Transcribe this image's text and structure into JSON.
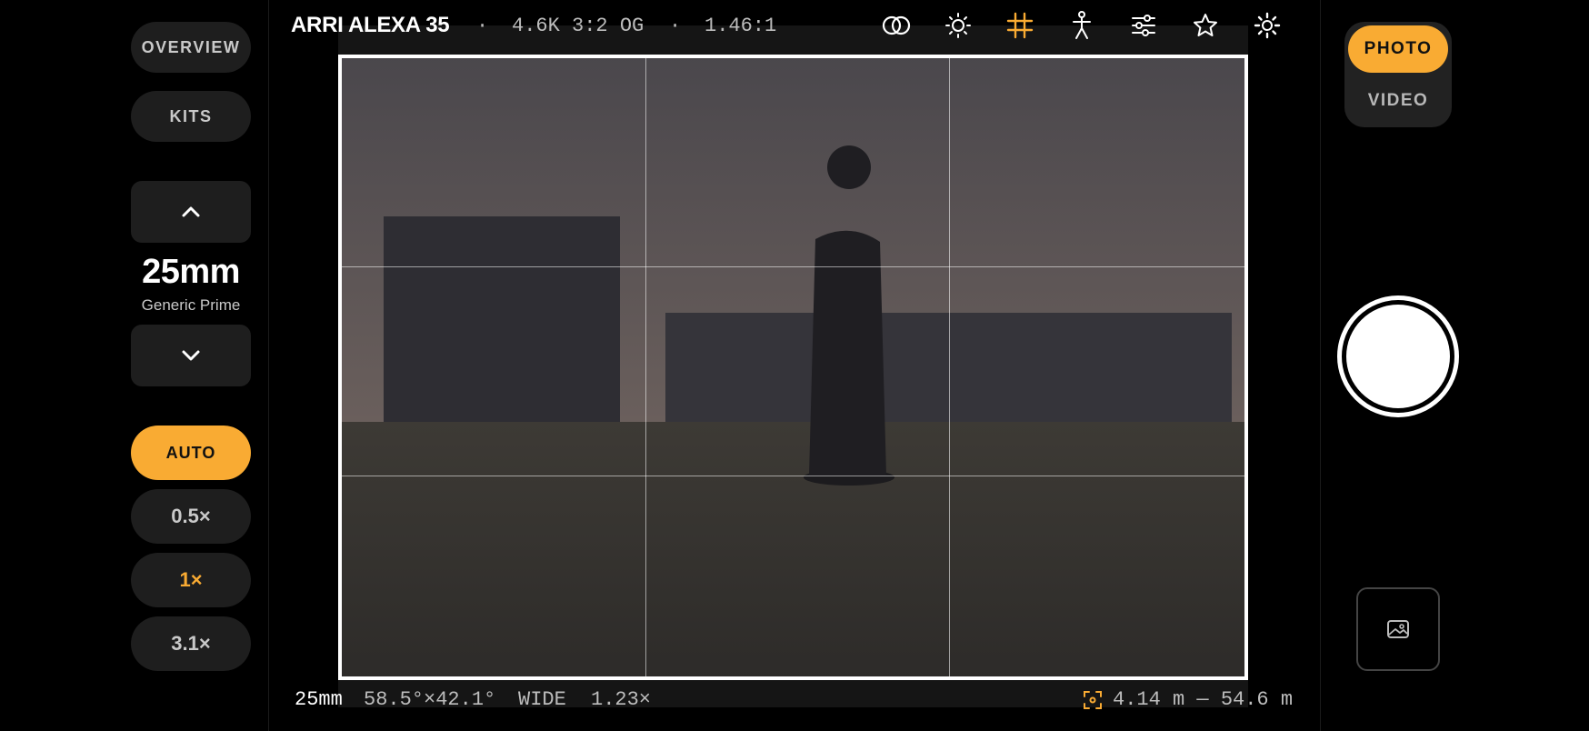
{
  "left_panel": {
    "overview_label": "OVERVIEW",
    "kits_label": "KITS",
    "lens": {
      "focal_length": "25mm",
      "name": "Generic Prime"
    },
    "zoom": {
      "auto_label": "AUTO",
      "options": [
        "0.5×",
        "1×",
        "3.1×"
      ],
      "selected": "1×"
    }
  },
  "top_bar": {
    "camera_name": "ARRI ALEXA 35",
    "separator": "·",
    "format": "4.6K 3:2 OG",
    "aspect_ratio": "1.46:1",
    "icons": [
      "overlay-icon",
      "exposure-icon",
      "grid-icon",
      "person-icon",
      "sliders-icon",
      "star-icon",
      "settings-sun-icon"
    ],
    "active_icon": "grid-icon"
  },
  "bottom_bar": {
    "focal_length": "25mm",
    "field_of_view": "58.5°×42.1°",
    "lens_class": "WIDE",
    "magnification": "1.23×",
    "dof_range": "4.14 m — 54.6 m"
  },
  "right_panel": {
    "modes": [
      "PHOTO",
      "VIDEO"
    ],
    "selected_mode": "PHOTO"
  },
  "colors": {
    "accent": "#f9ab33",
    "panel_button": "#1e1e1e",
    "background": "#000000"
  }
}
